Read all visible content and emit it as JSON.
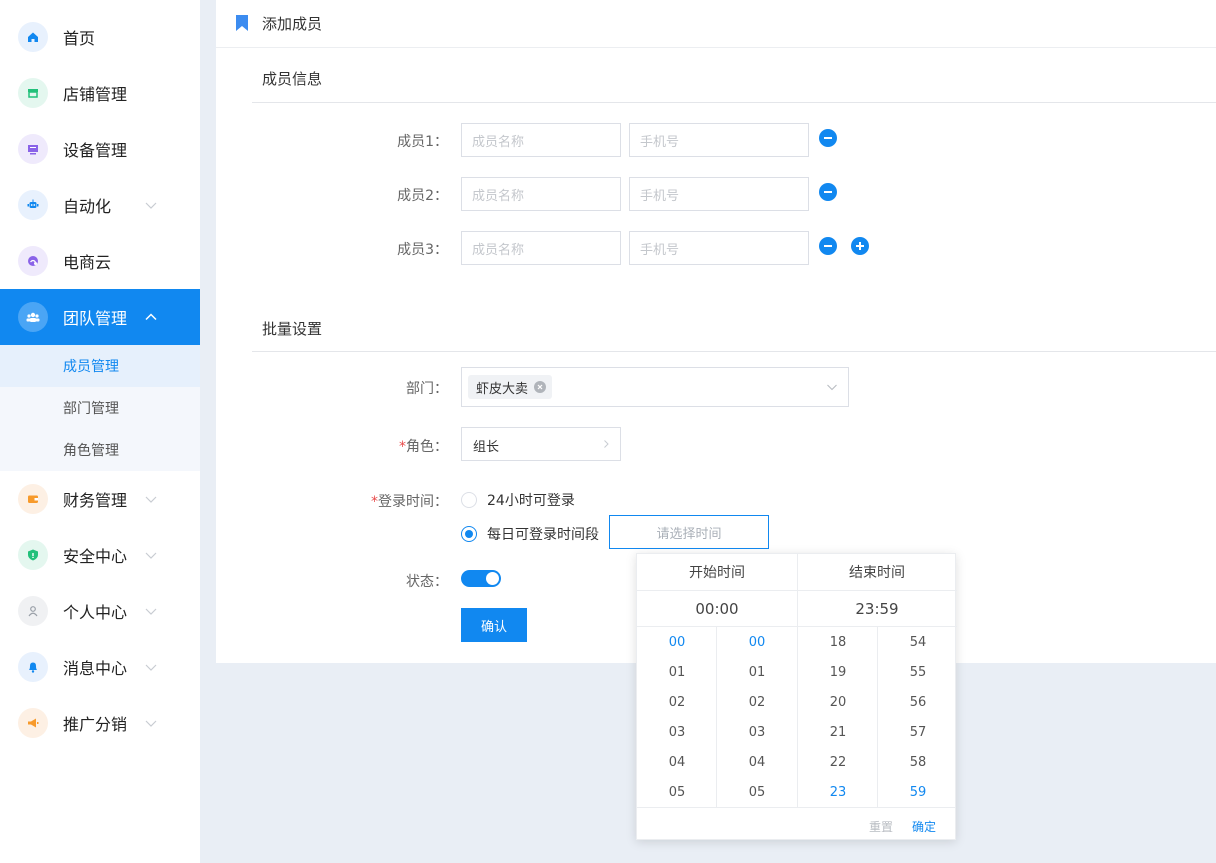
{
  "sidebar": {
    "items": [
      {
        "label": "首页",
        "icon": "home-icon"
      },
      {
        "label": "店铺管理",
        "icon": "store-icon"
      },
      {
        "label": "设备管理",
        "icon": "device-icon"
      },
      {
        "label": "自动化",
        "icon": "robot-icon"
      },
      {
        "label": "电商云",
        "icon": "cloud-shop-icon"
      },
      {
        "label": "团队管理",
        "icon": "team-icon",
        "active": true
      },
      {
        "label": "财务管理",
        "icon": "wallet-icon"
      },
      {
        "label": "安全中心",
        "icon": "shield-icon"
      },
      {
        "label": "个人中心",
        "icon": "user-icon"
      },
      {
        "label": "消息中心",
        "icon": "bell-icon"
      },
      {
        "label": "推广分销",
        "icon": "megaphone-icon"
      }
    ],
    "subitems": [
      {
        "label": "成员管理",
        "active": true
      },
      {
        "label": "部门管理"
      },
      {
        "label": "角色管理"
      }
    ]
  },
  "page": {
    "title": "添加成员",
    "member_section": "成员信息",
    "batch_section": "批量设置"
  },
  "members": [
    {
      "label": "成员1：",
      "name_placeholder": "成员名称",
      "phone_placeholder": "手机号"
    },
    {
      "label": "成员2：",
      "name_placeholder": "成员名称",
      "phone_placeholder": "手机号"
    },
    {
      "label": "成员3：",
      "name_placeholder": "成员名称",
      "phone_placeholder": "手机号"
    }
  ],
  "form": {
    "dept_label": "部门：",
    "dept_tag": "虾皮大卖",
    "role_required": "*",
    "role_label": "角色：",
    "role_value": "组长",
    "login_required": "*",
    "login_label": "登录时间：",
    "login_option_all": "24小时可登录",
    "login_option_period": "每日可登录时间段",
    "time_placeholder": "请选择时间",
    "status_label": "状态：",
    "confirm_label": "确认"
  },
  "picker": {
    "start_title": "开始时间",
    "end_title": "结束时间",
    "start_value": "00:00",
    "end_value": "23:59",
    "start_hours": [
      "00",
      "01",
      "02",
      "03",
      "04",
      "05"
    ],
    "start_minutes": [
      "00",
      "01",
      "02",
      "03",
      "04",
      "05"
    ],
    "end_hours": [
      "18",
      "19",
      "20",
      "21",
      "22",
      "23"
    ],
    "end_minutes": [
      "54",
      "55",
      "56",
      "57",
      "58",
      "59"
    ],
    "reset_label": "重置",
    "ok_label": "确定"
  },
  "colors": {
    "accent": "#1188f0",
    "required": "#e84a4a"
  }
}
